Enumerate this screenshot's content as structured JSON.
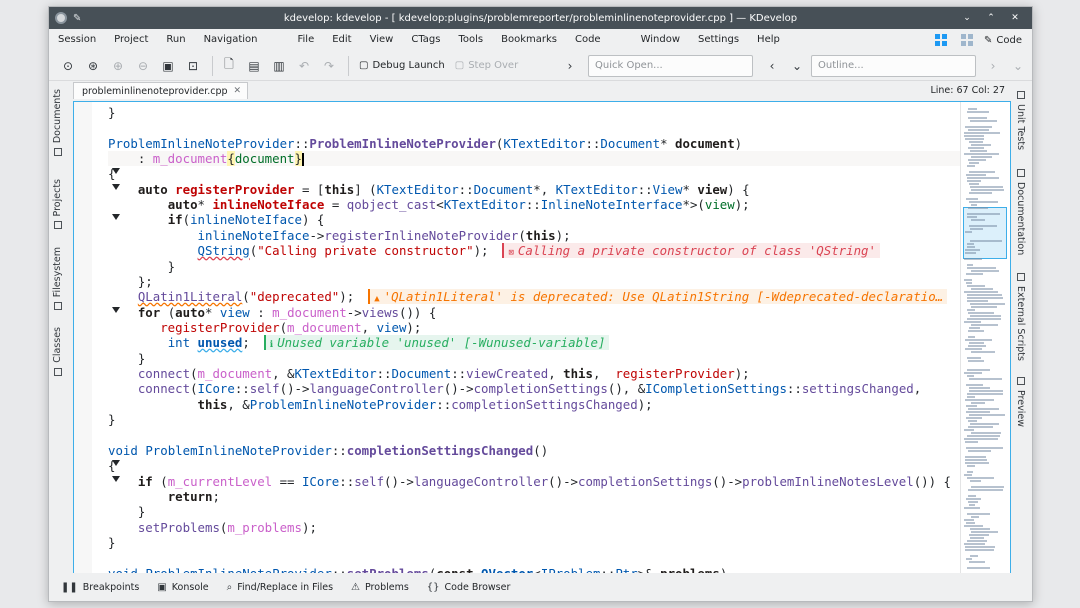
{
  "window": {
    "title": "kdevelop: kdevelop - [ kdevelop:plugins/problemreporter/probleminlinenoteprovider.cpp ] — KDevelop"
  },
  "menubar": {
    "items": [
      "Session",
      "Project",
      "Run",
      "Navigation",
      "File",
      "Edit",
      "View",
      "CTags",
      "Tools",
      "Bookmarks",
      "Code",
      "Window",
      "Settings",
      "Help"
    ],
    "code_area_label": "Code"
  },
  "toolbar": {
    "debug_launch": "Debug Launch",
    "step_over": "Step Over",
    "quick_open_placeholder": "Quick Open...",
    "outline_placeholder": "Outline..."
  },
  "left_tabs": [
    "Documents",
    "Projects",
    "Filesystem",
    "Classes"
  ],
  "right_tabs": [
    "Unit Tests",
    "Documentation",
    "External Scripts",
    "Preview"
  ],
  "document": {
    "tab_name": "probleminlinenoteprovider.cpp",
    "cursor_position": "Line: 67 Col: 27"
  },
  "notes": {
    "error_private_ctor": "Calling a private constructor of class 'QString'",
    "warn_deprecated": "'QLatin1Literal' is deprecated: Use QLatin1String [-Wdeprecated-declaratio…",
    "info_unused": "Unused variable 'unused' [-Wunused-variable]"
  },
  "bottom_tabs": [
    "Breakpoints",
    "Konsole",
    "Find/Replace in Files",
    "Problems",
    "Code Browser"
  ],
  "colors": {
    "titlebar": "#475057",
    "accent": "#3daee9",
    "error": "#da4453",
    "warning": "#f67400",
    "info": "#27ae60"
  }
}
